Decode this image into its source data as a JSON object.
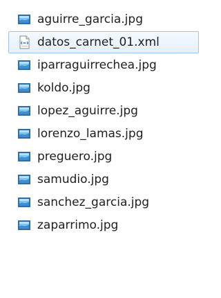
{
  "files": [
    {
      "name": "aguirre_garcia.jpg",
      "icon": "image-file-icon",
      "selected": false
    },
    {
      "name": "datos_carnet_01.xml",
      "icon": "xml-file-icon",
      "selected": true
    },
    {
      "name": "iparraguirrechea.jpg",
      "icon": "image-file-icon",
      "selected": false
    },
    {
      "name": "koldo.jpg",
      "icon": "image-file-icon",
      "selected": false
    },
    {
      "name": "lopez_aguirre.jpg",
      "icon": "image-file-icon",
      "selected": false
    },
    {
      "name": "lorenzo_lamas.jpg",
      "icon": "image-file-icon",
      "selected": false
    },
    {
      "name": "preguero.jpg",
      "icon": "image-file-icon",
      "selected": false
    },
    {
      "name": "samudio.jpg",
      "icon": "image-file-icon",
      "selected": false
    },
    {
      "name": "sanchez_garcia.jpg",
      "icon": "image-file-icon",
      "selected": false
    },
    {
      "name": "zaparrimo.jpg",
      "icon": "image-file-icon",
      "selected": false
    }
  ],
  "colors": {
    "selection_fill": "#e6f0fb",
    "selection_border": "#9fc3ea",
    "image_icon_frame": "#2f6ca8",
    "image_icon_fill": "#7bc4ec",
    "text": "#1e1e1e"
  }
}
